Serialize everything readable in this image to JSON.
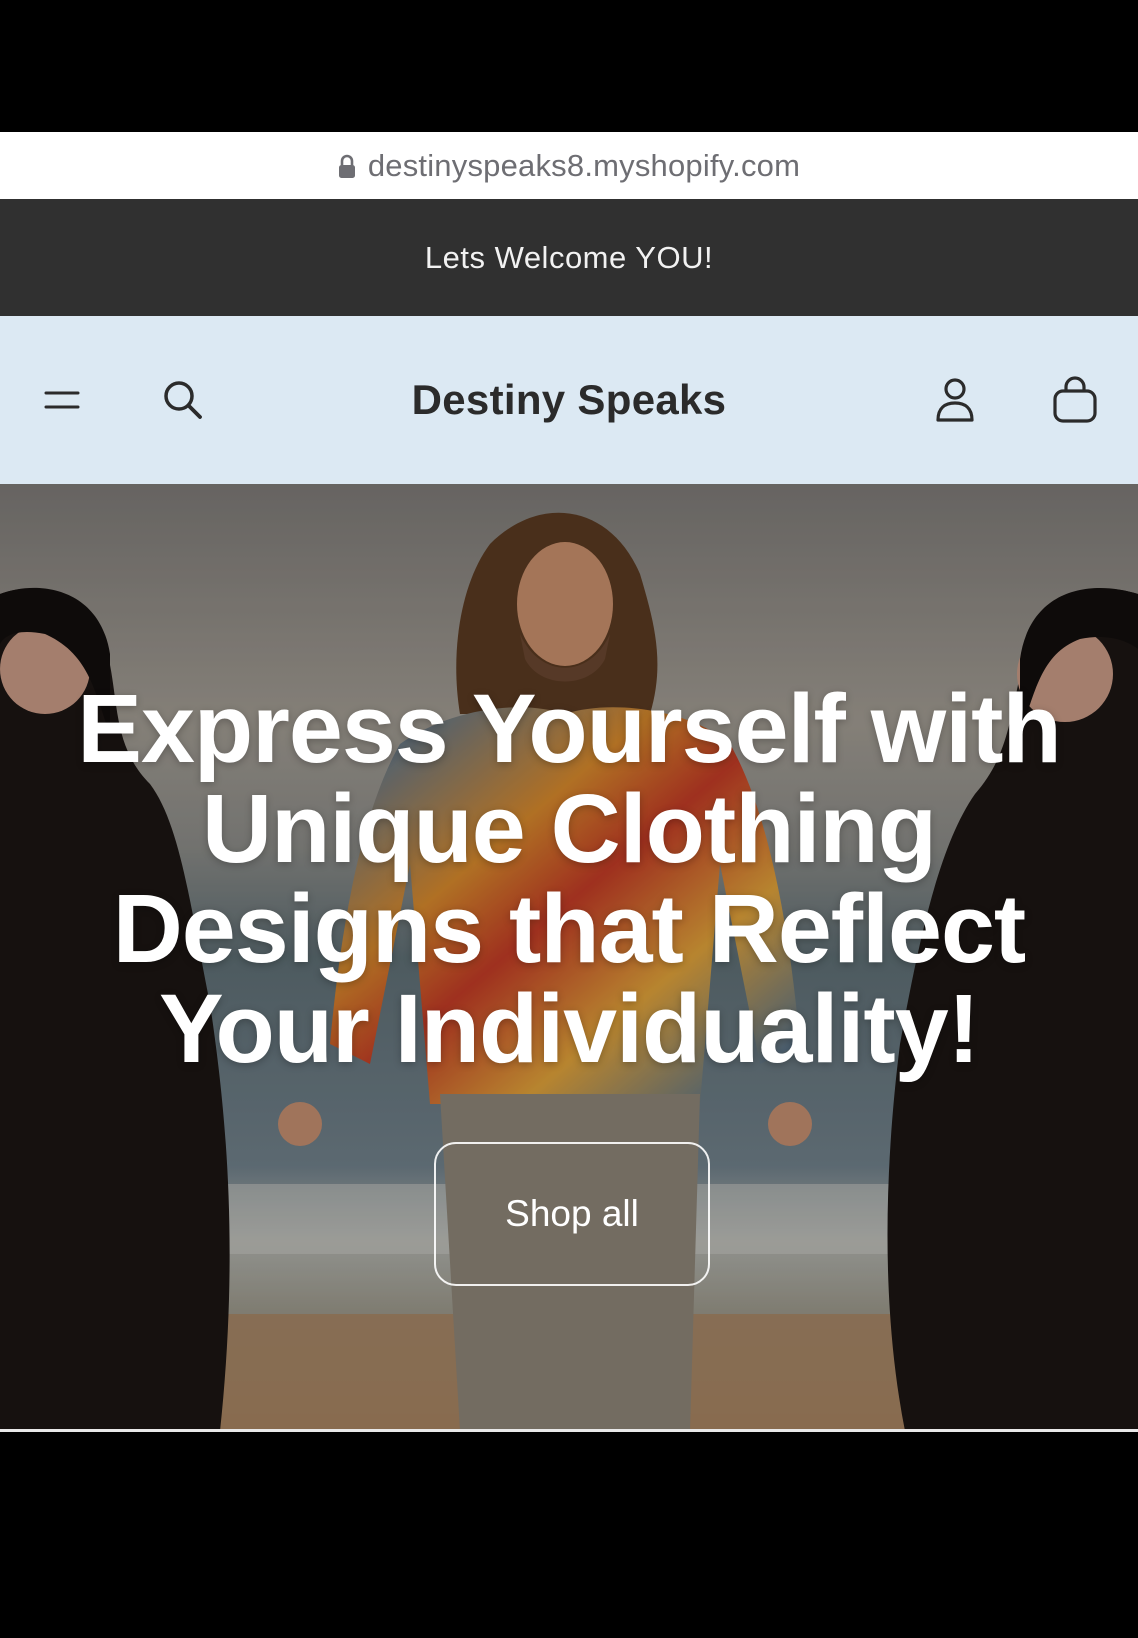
{
  "browser": {
    "url": "destinyspeaks8.myshopify.com",
    "lock_icon": "lock-icon"
  },
  "announcement": {
    "text": "Lets Welcome YOU!"
  },
  "header": {
    "brand": "Destiny Speaks",
    "background": "#dce9f3",
    "icons": [
      "menu-icon",
      "search-icon",
      "account-icon",
      "cart-icon"
    ]
  },
  "hero": {
    "heading": "Express Yourself with Unique Clothing Designs that Reflect Your Individuality!",
    "button_label": "Shop all"
  },
  "colors": {
    "announcement_bg": "#303030",
    "text_light": "#ffffff",
    "brand_text": "#2b2b2b"
  }
}
